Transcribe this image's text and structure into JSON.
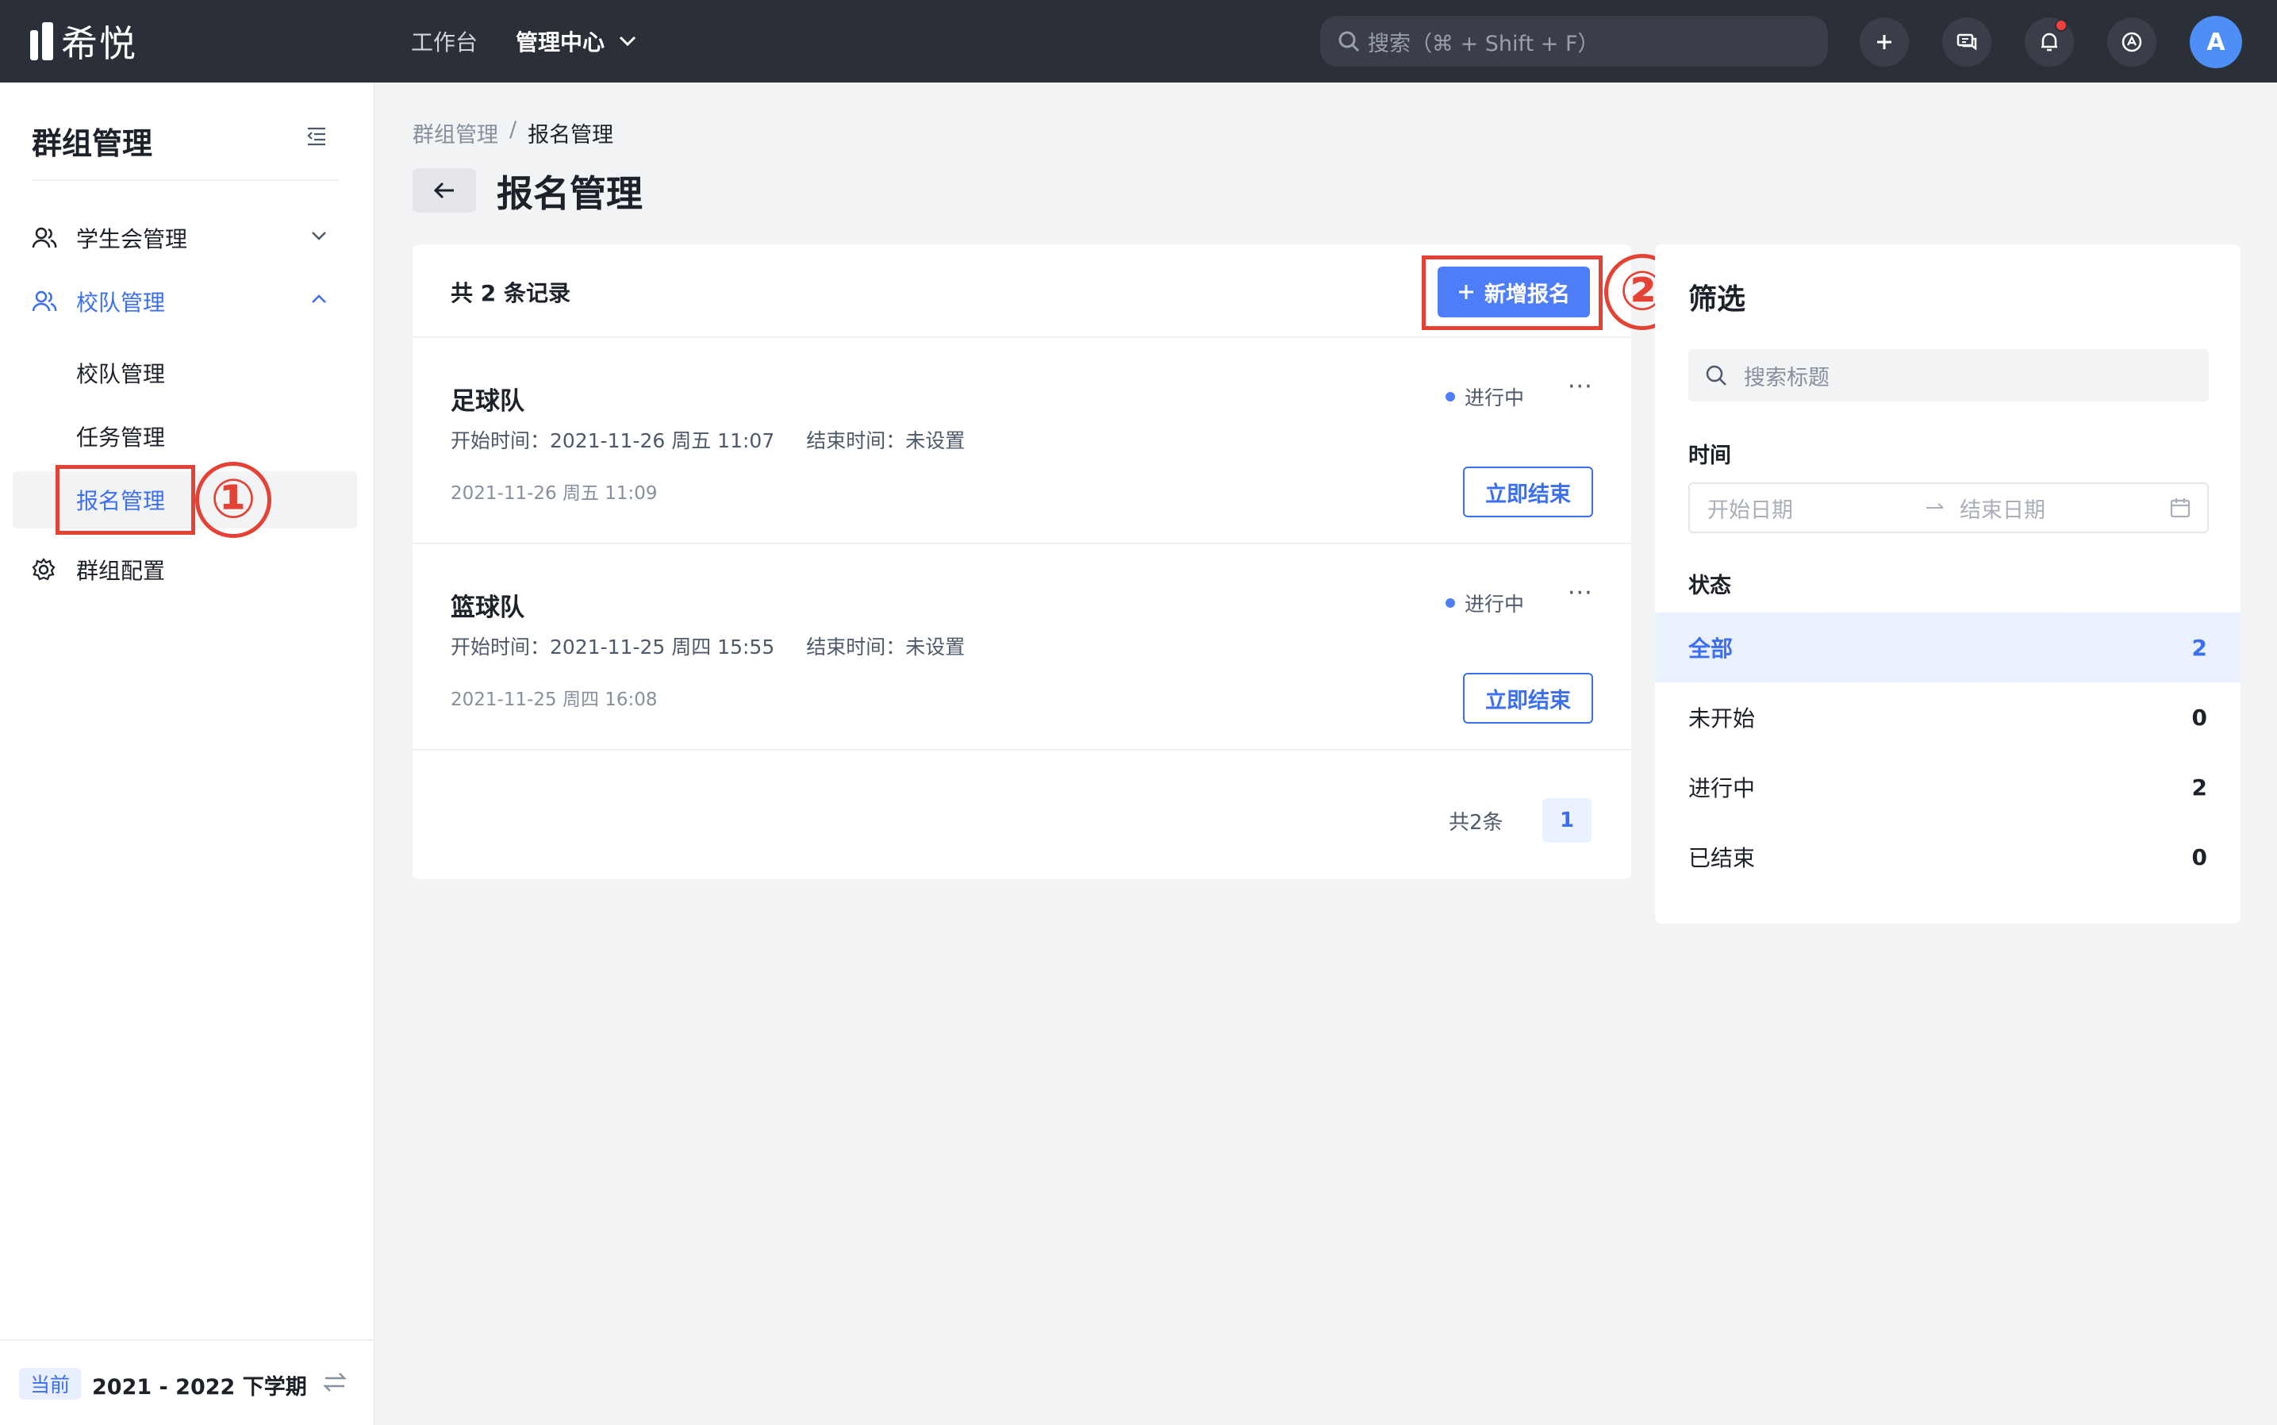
{
  "topbar": {
    "logo_text": "希悦",
    "nav": [
      {
        "label": "工作台",
        "active": false
      },
      {
        "label": "管理中心",
        "active": true
      }
    ],
    "search_placeholder": "搜索（⌘ + Shift + F）",
    "avatar_letter": "A",
    "icons": [
      "plus-icon",
      "message-icon",
      "bell-icon",
      "help-icon"
    ]
  },
  "sidebar": {
    "title": "群组管理",
    "menu": [
      {
        "label": "学生会管理",
        "icon": "users-icon",
        "expanded": false
      },
      {
        "label": "校队管理",
        "icon": "users-icon",
        "expanded": true,
        "children": [
          {
            "label": "校队管理",
            "active": false
          },
          {
            "label": "任务管理",
            "active": false
          },
          {
            "label": "报名管理",
            "active": true
          }
        ]
      },
      {
        "label": "群组配置",
        "icon": "gear-icon",
        "expanded": false
      }
    ],
    "footer": {
      "tag": "当前",
      "term": "2021 - 2022 下学期"
    }
  },
  "annotations": {
    "step1": "①",
    "step2": "②"
  },
  "breadcrumb": [
    "群组管理",
    "/",
    "报名管理"
  ],
  "page_title": "报名管理",
  "list": {
    "header": "共 2 条记录",
    "add_button": "新增报名",
    "records": [
      {
        "title": "足球队",
        "status": "进行中",
        "start": "开始时间：2021-11-26 周五 11:07",
        "end": "结束时间：未设置",
        "created": "2021-11-26 周五 11:09",
        "action": "立即结束"
      },
      {
        "title": "篮球队",
        "status": "进行中",
        "start": "开始时间：2021-11-25 周四 15:55",
        "end": "结束时间：未设置",
        "created": "2021-11-25 周四 16:08",
        "action": "立即结束"
      }
    ],
    "pager_total": "共2条",
    "pager_page": "1"
  },
  "filter": {
    "title": "筛选",
    "search_placeholder": "搜索标题",
    "time_label": "时间",
    "date_start": "开始日期",
    "date_end": "结束日期",
    "status_label": "状态",
    "statuses": [
      {
        "label": "全部",
        "count": "2",
        "selected": true
      },
      {
        "label": "未开始",
        "count": "0",
        "selected": false
      },
      {
        "label": "进行中",
        "count": "2",
        "selected": false
      },
      {
        "label": "已结束",
        "count": "0",
        "selected": false
      }
    ]
  },
  "colors": {
    "primary": "#4e7ef7",
    "annotation": "#e34234",
    "topbar": "#2b2f38"
  }
}
